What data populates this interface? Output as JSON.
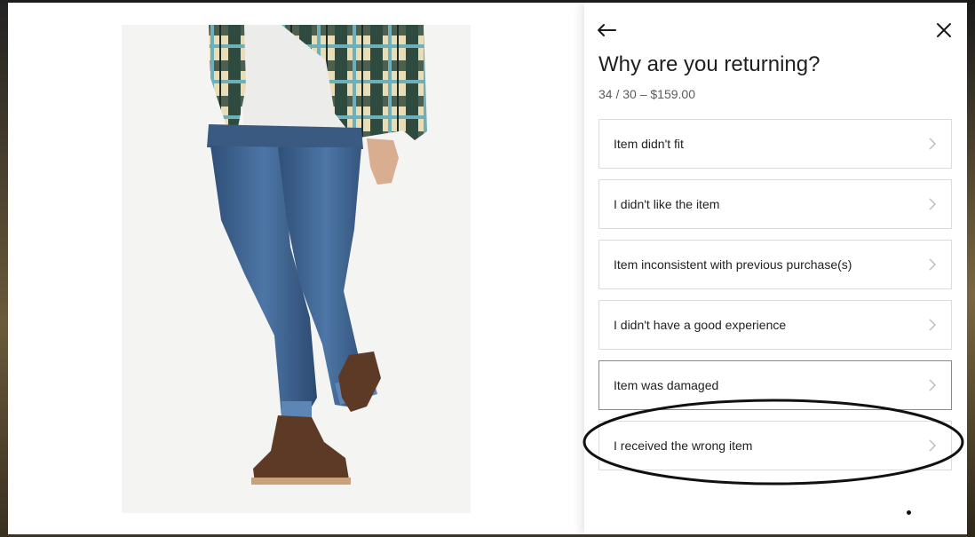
{
  "modal": {
    "title": "Why are you returning?",
    "subtitle": "34 / 30 – $159.00",
    "back_icon": "arrow-left-icon",
    "close_icon": "close-icon",
    "reasons": [
      {
        "label": "Item didn't fit"
      },
      {
        "label": "I didn't like the item"
      },
      {
        "label": "Item inconsistent with previous purchase(s)"
      },
      {
        "label": "I didn't have a good experience"
      },
      {
        "label": "Item was damaged"
      },
      {
        "label": "I received the wrong item"
      }
    ],
    "reason_icon": "chevron-right-icon"
  },
  "product_image": {
    "subject": "model wearing plaid flannel shirt, slim blue jeans and brown chukka boots"
  },
  "colors": {
    "panel_bg": "#ffffff",
    "border": "#dcdcdc",
    "text": "#222222",
    "muted": "#5c5c5c",
    "annotation": "#111111"
  }
}
